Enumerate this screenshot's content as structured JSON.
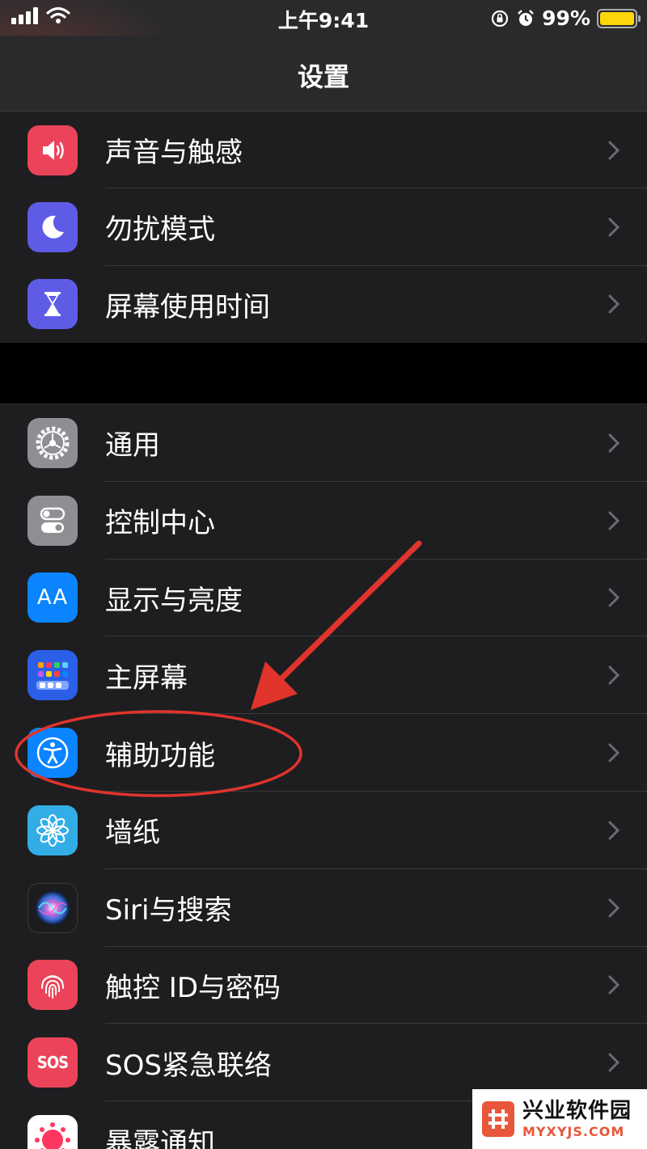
{
  "status_bar": {
    "time": "上午9:41",
    "battery_percent": "99%",
    "battery_color": "#ffd60a",
    "icons": [
      "signal-icon",
      "wifi-icon",
      "orientation-lock-icon",
      "alarm-icon",
      "battery-icon"
    ]
  },
  "nav": {
    "title": "设置"
  },
  "group1": {
    "items": [
      {
        "label": "声音与触感",
        "icon": "speaker-icon",
        "color": "#eb445a"
      },
      {
        "label": "勿扰模式",
        "icon": "moon-icon",
        "color": "#5e5ce6"
      },
      {
        "label": "屏幕使用时间",
        "icon": "hourglass-icon",
        "color": "#5e5ce6"
      }
    ]
  },
  "group2": {
    "items": [
      {
        "label": "通用",
        "icon": "gear-icon",
        "color": "#8e8e93"
      },
      {
        "label": "控制中心",
        "icon": "toggles-icon",
        "color": "#8e8e93"
      },
      {
        "label": "显示与亮度",
        "icon": "aa-text-icon",
        "icon_text": "AA",
        "color": "#0a84ff"
      },
      {
        "label": "主屏幕",
        "icon": "home-grid-icon",
        "color": "#2c5fe8"
      },
      {
        "label": "辅助功能",
        "icon": "accessibility-icon",
        "color": "#0a84ff"
      },
      {
        "label": "墙纸",
        "icon": "flower-icon",
        "color": "#32ade6"
      },
      {
        "label": "Siri与搜索",
        "icon": "siri-icon",
        "color": "#1c1c1e"
      },
      {
        "label": "触控 ID与密码",
        "icon": "fingerprint-icon",
        "color": "#eb445a"
      },
      {
        "label": "SOS紧急联络",
        "icon": "sos-icon",
        "icon_text": "SOS",
        "color": "#eb445a"
      },
      {
        "label": "暴露通知",
        "icon": "exposure-icon",
        "color": "#ffffff"
      }
    ]
  },
  "annotation": {
    "color": "#e0342c"
  },
  "watermark": {
    "title": "兴业软件园",
    "url": "MYXYJS.COM"
  }
}
